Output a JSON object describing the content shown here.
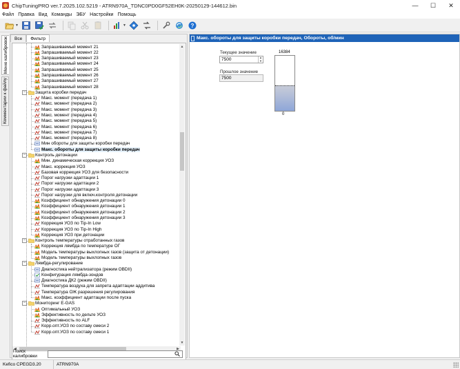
{
  "window": {
    "title": "ChipTuningPRO ver.7.2025.102.5219 - ATRN970A_TDNC0PD0GF52EH0K-20250129-144612.bin",
    "buttons": {
      "minimize": "—",
      "maximize": "☐",
      "close": "✕"
    }
  },
  "menu": [
    "Файл",
    "Правка",
    "Вид",
    "Команды",
    "ЭБУ",
    "Настройки",
    "Помощь"
  ],
  "vtabs": [
    "Меню калибровок",
    "Комментарии к файлу"
  ],
  "htabs": [
    "Все",
    "Фильтр"
  ],
  "tree": [
    {
      "level": 3,
      "icon": "map3d-icon",
      "label": "Запрашиваемый момент 21"
    },
    {
      "level": 3,
      "icon": "map3d-icon",
      "label": "Запрашиваемый момент 22"
    },
    {
      "level": 3,
      "icon": "map3d-icon",
      "label": "Запрашиваемый момент 23"
    },
    {
      "level": 3,
      "icon": "map3d-icon",
      "label": "Запрашиваемый момент 24"
    },
    {
      "level": 3,
      "icon": "map3d-icon",
      "label": "Запрашиваемый момент 25"
    },
    {
      "level": 3,
      "icon": "map3d-icon",
      "label": "Запрашиваемый момент 26"
    },
    {
      "level": 3,
      "icon": "map3d-icon",
      "label": "Запрашиваемый момент 27"
    },
    {
      "level": 3,
      "icon": "map3d-icon",
      "label": "Запрашиваемый момент 28"
    },
    {
      "level": 2,
      "icon": "folder-icon",
      "label": "Защита коробки передач",
      "group": true
    },
    {
      "level": 3,
      "icon": "map2d-icon",
      "label": "Макс. момент (передача 1)"
    },
    {
      "level": 3,
      "icon": "map2d-icon",
      "label": "Макс. момент (передача 2)"
    },
    {
      "level": 3,
      "icon": "map2d-icon",
      "label": "Макс. момент (передача 3)"
    },
    {
      "level": 3,
      "icon": "map2d-icon",
      "label": "Макс. момент (передача 4)"
    },
    {
      "level": 3,
      "icon": "map2d-icon",
      "label": "Макс. момент (передача 5)"
    },
    {
      "level": 3,
      "icon": "map2d-icon",
      "label": "Макс. момент (передача 6)"
    },
    {
      "level": 3,
      "icon": "map2d-icon",
      "label": "Макс. момент (передача 7)"
    },
    {
      "level": 3,
      "icon": "map2d-icon",
      "label": "Макс. момент (передача 8)"
    },
    {
      "level": 3,
      "icon": "const-icon",
      "label": "Мин обороты для защиты коробки передач"
    },
    {
      "level": 3,
      "icon": "const-icon",
      "label": "Макс. обороты для защиты коробки передач",
      "selected": true
    },
    {
      "level": 2,
      "icon": "folder-icon",
      "label": "Контроль детонации",
      "group": true
    },
    {
      "level": 3,
      "icon": "map3d-icon",
      "label": "Мин. динамическая коррекция УОЗ"
    },
    {
      "level": 3,
      "icon": "map2d-icon",
      "label": "Макс. коррекция УОЗ"
    },
    {
      "level": 3,
      "icon": "map2d-icon",
      "label": "Базовая коррекция УОЗ для безопасности"
    },
    {
      "level": 3,
      "icon": "map2d-icon",
      "label": "Порог нагрузки адаптации 1"
    },
    {
      "level": 3,
      "icon": "map2d-icon",
      "label": "Порог нагрузки адаптации 2"
    },
    {
      "level": 3,
      "icon": "map2d-icon",
      "label": "Порог нагрузки адаптации 3"
    },
    {
      "level": 3,
      "icon": "map2d-icon",
      "label": "Порог нагрузки для включ.контроля детонации"
    },
    {
      "level": 3,
      "icon": "map3d-icon",
      "label": "Коэффициент обнаружения детонации 0"
    },
    {
      "level": 3,
      "icon": "map3d-icon",
      "label": "Коэффициент обнаружения детонации 1"
    },
    {
      "level": 3,
      "icon": "map3d-icon",
      "label": "Коэффициент обнаружения детонации 2"
    },
    {
      "level": 3,
      "icon": "map3d-icon",
      "label": "Коэффициент обнаружения детонации 3"
    },
    {
      "level": 3,
      "icon": "map2d-icon",
      "label": "Коррекция УОЗ по Tip-In Low"
    },
    {
      "level": 3,
      "icon": "map2d-icon",
      "label": "Коррекция УОЗ по Tip-In High"
    },
    {
      "level": 3,
      "icon": "map3d-icon",
      "label": "Коррекция УОЗ при детонации"
    },
    {
      "level": 2,
      "icon": "folder-icon",
      "label": "Контроль температуры отработанных газов",
      "group": true
    },
    {
      "level": 3,
      "icon": "map3d-icon",
      "label": "Коррекция лямбда по температуре ОГ"
    },
    {
      "level": 3,
      "icon": "map3d-icon",
      "label": "Модель температуры выхлопных газов (защита от детонации)"
    },
    {
      "level": 3,
      "icon": "map3d-icon",
      "label": "Модель температуры выхлопных газов"
    },
    {
      "level": 2,
      "icon": "folder-icon",
      "label": "Лямбда-регулирование",
      "group": true
    },
    {
      "level": 3,
      "icon": "const-icon",
      "label": "Диагностика нейтрализатора (режим OBDII)"
    },
    {
      "level": 3,
      "icon": "check-icon",
      "label": "Конфигурация лямбда-зондов"
    },
    {
      "level": 3,
      "icon": "const-icon",
      "label": "Диагностика ДК2 (режим OBDII)"
    },
    {
      "level": 3,
      "icon": "map2d-icon",
      "label": "Температура воздуха для запрета адаптации аддитива"
    },
    {
      "level": 3,
      "icon": "map2d-icon",
      "label": "Температура ОЖ разрешения регулирования"
    },
    {
      "level": 3,
      "icon": "map3d-icon",
      "label": "Макс. коэффициент адаптации после пуска"
    },
    {
      "level": 2,
      "icon": "folder-icon",
      "label": "Мониторинг E-GAS",
      "group": true
    },
    {
      "level": 3,
      "icon": "map3d-icon",
      "label": "Оптимальный УОЗ"
    },
    {
      "level": 3,
      "icon": "map3d-icon",
      "label": "Эффективность по дельте УОЗ"
    },
    {
      "level": 3,
      "icon": "map2d-icon",
      "label": "Эффективность по ALF"
    },
    {
      "level": 3,
      "icon": "map2d-icon",
      "label": "Корр.опт.УОЗ по составу смеси 2"
    },
    {
      "level": 3,
      "icon": "map2d-icon",
      "label": "Корр.опт.УОЗ по составу смеси 1"
    }
  ],
  "search": {
    "label": "Поиск калибровки",
    "value": "",
    "placeholder": ""
  },
  "editor": {
    "header": "Макс. обороты для защиты коробки передач, Обороты, об/мин",
    "current_label": "Текущее значение",
    "current_value": "7500",
    "previous_label": "Прошлое значение",
    "previous_value": "7500",
    "gauge_max": "16384",
    "gauge_min": "0",
    "gauge_level": 0.458
  },
  "status": {
    "left": "Kefico CPEGD3.20",
    "right": "ATRN970A"
  }
}
